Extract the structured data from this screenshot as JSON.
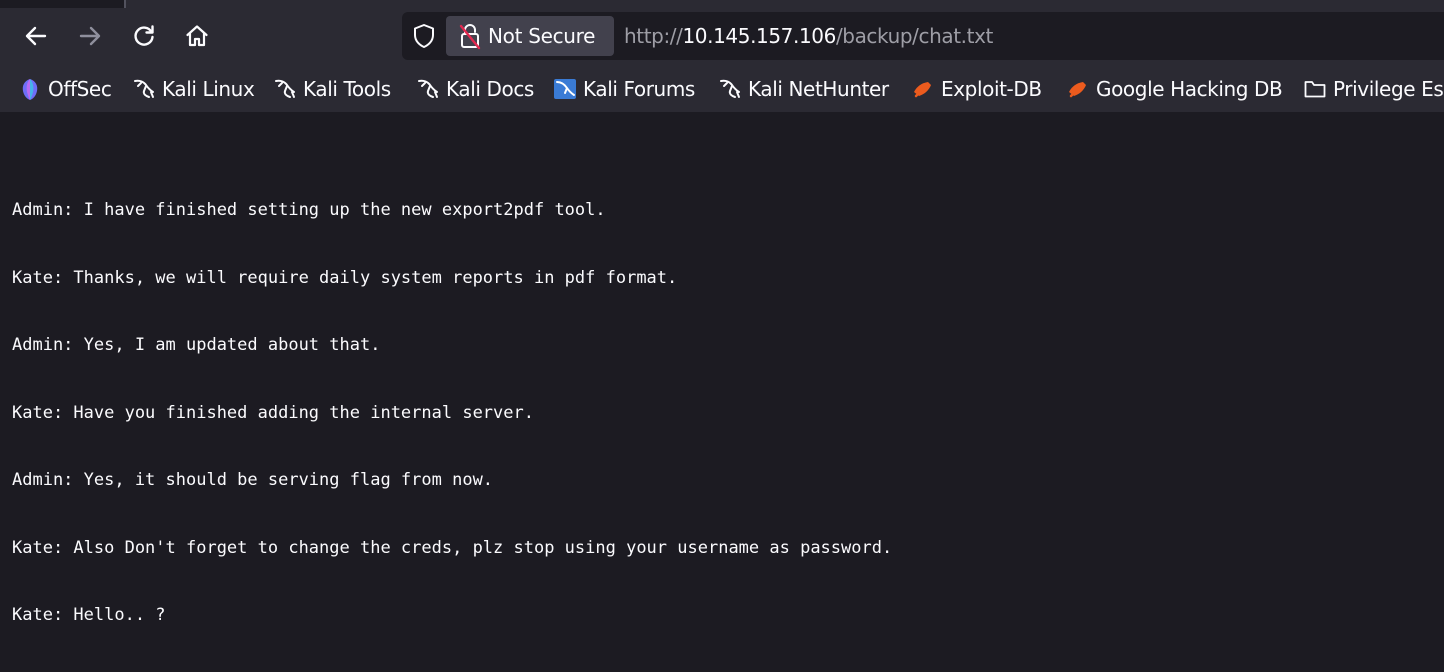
{
  "browser": {
    "nav": {
      "back_icon": "arrow-left-icon",
      "forward_icon": "arrow-right-icon",
      "reload_icon": "reload-icon",
      "home_icon": "home-icon"
    },
    "urlbar": {
      "security_label": "Not Secure",
      "url_scheme": "http://",
      "url_host": "10.145.157.106",
      "url_path": "/backup/chat.txt"
    },
    "bookmarks": [
      {
        "label": "OffSec",
        "icon": "offsec-icon"
      },
      {
        "label": "Kali Linux",
        "icon": "kali-dragon-icon"
      },
      {
        "label": "Kali Tools",
        "icon": "kali-dragon-icon"
      },
      {
        "label": "Kali Docs",
        "icon": "kali-dragon-icon"
      },
      {
        "label": "Kali Forums",
        "icon": "kali-forums-icon"
      },
      {
        "label": "Kali NetHunter",
        "icon": "kali-dragon-icon"
      },
      {
        "label": "Exploit-DB",
        "icon": "exploit-db-icon"
      },
      {
        "label": "Google Hacking DB",
        "icon": "exploit-db-icon"
      },
      {
        "label": "Privilege Es",
        "icon": "folder-icon"
      }
    ]
  },
  "document": {
    "lines": [
      "Admin: I have finished setting up the new export2pdf tool.",
      "Kate: Thanks, we will require daily system reports in pdf format.",
      "Admin: Yes, I am updated about that.",
      "Kate: Have you finished adding the internal server.",
      "Admin: Yes, it should be serving flag from now.",
      "Kate: Also Don't forget to change the creds, plz stop using your username as password.",
      "Kate: Hello.. ?"
    ]
  },
  "colors": {
    "toolbar_bg": "#2b2a33",
    "page_bg": "#1c1b22",
    "text": "#fbfbfe",
    "url_dim": "#9e9ea6",
    "insecure_red": "#e22850",
    "exploit_orange": "#ec5b1e"
  }
}
